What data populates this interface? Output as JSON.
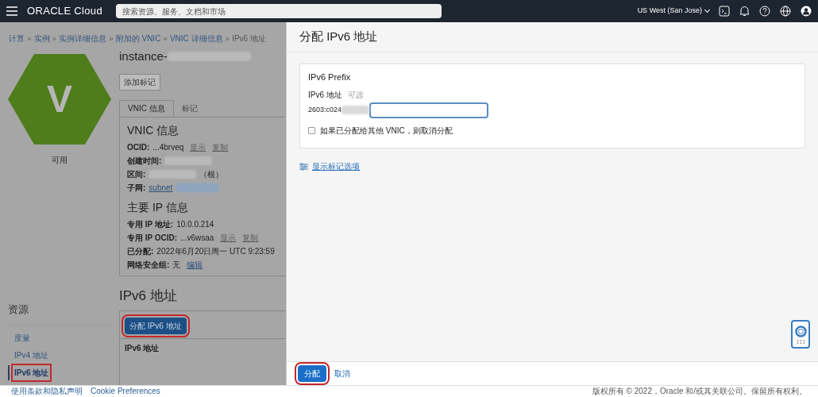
{
  "header": {
    "brand": "ORACLE Cloud",
    "search": {
      "placeholder": "搜索资源、服务、文档和市场"
    },
    "region": "US West (San Jose)"
  },
  "breadcrumb": {
    "separator": "»",
    "items": [
      {
        "label": "计算",
        "link": true
      },
      {
        "label": "实例",
        "link": true
      },
      {
        "label": "实例详细信息",
        "link": true
      },
      {
        "label": "附加的 VNIC",
        "link": true
      },
      {
        "label": "VNIC 详细信息",
        "link": true
      },
      {
        "label": "IPv6 地址",
        "link": false
      }
    ]
  },
  "instance": {
    "title": "instance-",
    "badge_letter": "V",
    "status": "可用",
    "add_tag_button": "添加标记"
  },
  "tabs": [
    {
      "label": "VNIC 信息",
      "selected": true
    },
    {
      "label": "标记",
      "selected": false
    }
  ],
  "vnic_info": {
    "title": "VNIC 信息",
    "rows": [
      {
        "label": "OCID:",
        "value": "...4brveq",
        "value_link": false,
        "redacted": false,
        "links": [
          "显示",
          "复制"
        ]
      },
      {
        "label": "创建时间:",
        "value_link": false,
        "redacted": true,
        "links": []
      },
      {
        "label": "区间:",
        "value_link": false,
        "redacted": true,
        "suffix": "（根）",
        "links": []
      },
      {
        "label": "子网:",
        "value": "subnet",
        "value_link": true,
        "redacted": true,
        "links": []
      }
    ]
  },
  "primary_ip": {
    "title": "主要 IP 信息",
    "rows": [
      {
        "label": "专用 IP 地址:",
        "value": "10.0.0.214",
        "value_link": false,
        "redacted": false,
        "links": []
      },
      {
        "label": "专用 IP OCID:",
        "value": "...v6wsaa",
        "value_link": false,
        "redacted": false,
        "links": [
          "显示",
          "复制"
        ]
      },
      {
        "label": "已分配:",
        "value": "2022年6月20日周一 UTC 9:23:59",
        "value_link": false,
        "redacted": false,
        "links": []
      },
      {
        "label": "网络安全组:",
        "value": "无",
        "value_link": false,
        "redacted": false,
        "links": [
          "编辑"
        ]
      }
    ]
  },
  "resources": {
    "title": "资源",
    "items": [
      {
        "label": "度量",
        "selected": false,
        "highlighted": false
      },
      {
        "label": "IPv4 地址",
        "selected": false,
        "highlighted": false
      },
      {
        "label": "IPv6 地址",
        "selected": true,
        "highlighted": true
      }
    ]
  },
  "ipv6_section": {
    "title": "IPv6 地址",
    "button": {
      "label": "分配 IPv6 地址",
      "highlighted": true
    },
    "columns": [
      "IPv6 地址"
    ]
  },
  "footer": {
    "links": [
      "使用条款和隐私声明",
      "Cookie Preferences"
    ],
    "copyright": "版权所有 © 2022，Oracle 和/或其关联公司。保留所有权利。"
  },
  "dialog": {
    "title": "分配 IPv6 地址",
    "card_title": "IPv6 Prefix",
    "field_label": "IPv6 地址",
    "field_hint": "可选",
    "prefix": "2603:c024",
    "prefix_redacted": true,
    "checkbox": {
      "label": "如果已分配给其他 VNIC，则取消分配",
      "checked": false
    },
    "tag_link": "显示标记选项",
    "submit": {
      "label": "分配",
      "highlighted": true
    },
    "cancel": "取消"
  }
}
